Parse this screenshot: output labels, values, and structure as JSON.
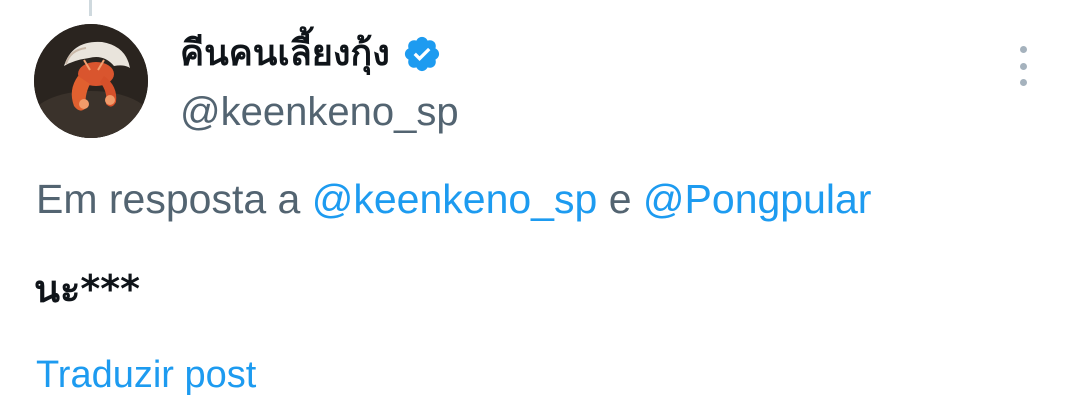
{
  "post": {
    "author": {
      "display_name": "คีนคนเลี้ยงกุ้ง",
      "handle": "@keenkeno_sp",
      "verified": true,
      "verified_icon": "verified-badge-icon",
      "avatar_icon": "hermit-crab-avatar"
    },
    "reply": {
      "prefix": "Em resposta a",
      "mention_1": "@keenkeno_sp",
      "conjunction": "e",
      "mention_2": "@Pongpular"
    },
    "text": "นะ***",
    "translate_label": "Traduzir post",
    "more_icon": "more-options-icon"
  },
  "colors": {
    "text_primary": "#0f1419",
    "text_secondary": "#536471",
    "link": "#1d9bf0",
    "verified": "#1d9bf0",
    "more_dots": "#a5b2bd"
  }
}
